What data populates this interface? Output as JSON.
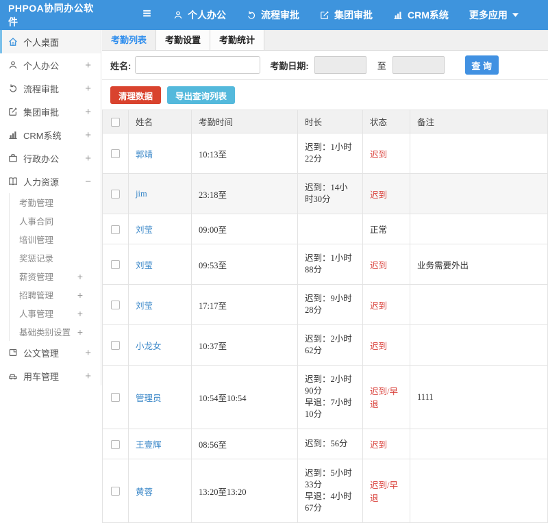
{
  "colors": {
    "header_bg": "#3E94DD",
    "active_tab_blue": "#2E8DED",
    "sidebar_active_border": "#7AC0EA",
    "link_blue": "#3A87C8",
    "danger_red": "#D9432E",
    "info_teal": "#54B9DC",
    "status_red": "#D9403A",
    "search_btn_blue": "#4191E2"
  },
  "header": {
    "logo": "PHPOA协同办公软件",
    "menu_icon": "hamburger-icon",
    "nav": [
      {
        "label": "个人办公",
        "icon": "user-icon"
      },
      {
        "label": "流程审批",
        "icon": "flow-icon"
      },
      {
        "label": "集团审批",
        "icon": "edit-icon"
      },
      {
        "label": "CRM系统",
        "icon": "chart-icon"
      },
      {
        "label": "更多应用",
        "icon": "caret-down-icon"
      }
    ]
  },
  "sidebar": {
    "items": [
      {
        "label": "个人桌面",
        "icon": "home-icon",
        "active": true
      },
      {
        "label": "个人办公",
        "icon": "user-icon",
        "expand": "+"
      },
      {
        "label": "流程审批",
        "icon": "flow-icon",
        "expand": "+"
      },
      {
        "label": "集团审批",
        "icon": "edit-icon",
        "expand": "+"
      },
      {
        "label": "CRM系统",
        "icon": "chart-icon",
        "expand": "+"
      },
      {
        "label": "行政办公",
        "icon": "briefcase-icon",
        "expand": "+"
      },
      {
        "label": "人力资源",
        "icon": "book-icon",
        "expand": "−",
        "children": [
          {
            "label": "考勤管理"
          },
          {
            "label": "人事合同"
          },
          {
            "label": "培训管理"
          },
          {
            "label": "奖惩记录"
          },
          {
            "label": "薪资管理",
            "expand": "+"
          },
          {
            "label": "招聘管理",
            "expand": "+"
          },
          {
            "label": "人事管理",
            "expand": "+"
          },
          {
            "label": "基础类别设置",
            "expand": "+"
          }
        ]
      },
      {
        "label": "公文管理",
        "icon": "doc-icon",
        "expand": "+"
      },
      {
        "label": "用车管理",
        "icon": "car-icon",
        "expand": "+"
      }
    ]
  },
  "tabs": [
    {
      "label": "考勤列表",
      "active": true
    },
    {
      "label": "考勤设置",
      "active": false
    },
    {
      "label": "考勤统计",
      "active": false
    }
  ],
  "filter": {
    "name_label": "姓名:",
    "name_value": "",
    "date_label": "考勤日期:",
    "date_from_value": "",
    "to_label": "至",
    "date_to_value": "",
    "search_label": "查 询"
  },
  "toolbar": {
    "clean_label": "清理数据",
    "export_label": "导出查询列表"
  },
  "table": {
    "columns": [
      "姓名",
      "考勤时间",
      "时长",
      "状态",
      "备注"
    ],
    "rows": [
      {
        "name": "郭靖",
        "time": "10:13至",
        "duration": [
          "迟到：1小时22分"
        ],
        "status": "迟到",
        "remark": "",
        "highlight": false
      },
      {
        "name": "jim",
        "time": "23:18至",
        "duration": [
          "迟到：14小时30分"
        ],
        "status": "迟到",
        "remark": "",
        "highlight": true
      },
      {
        "name": "刘莹",
        "time": "09:00至",
        "duration": [],
        "status": "正常",
        "remark": "",
        "highlight": false
      },
      {
        "name": "刘莹",
        "time": "09:53至",
        "duration": [
          "迟到：1小时88分"
        ],
        "status": "迟到",
        "remark": "业务需要外出",
        "highlight": false
      },
      {
        "name": "刘莹",
        "time": "17:17至",
        "duration": [
          "迟到：9小时28分"
        ],
        "status": "迟到",
        "remark": "",
        "highlight": false
      },
      {
        "name": "小龙女",
        "time": "10:37至",
        "duration": [
          "迟到：2小时62分"
        ],
        "status": "迟到",
        "remark": "",
        "highlight": false
      },
      {
        "name": "管理员",
        "time": "10:54至10:54",
        "duration": [
          "迟到：2小时90分",
          "早退：7小时10分"
        ],
        "status": "迟到/早退",
        "remark": "1111",
        "highlight": false
      },
      {
        "name": "王壹辉",
        "time": "08:56至",
        "duration": [
          "迟到：56分"
        ],
        "status": "迟到",
        "remark": "",
        "highlight": false
      },
      {
        "name": "黄蓉",
        "time": "13:20至13:20",
        "duration": [
          "迟到：5小时33分",
          "早退：4小时67分"
        ],
        "status": "迟到/早退",
        "remark": "",
        "highlight": false
      }
    ]
  }
}
